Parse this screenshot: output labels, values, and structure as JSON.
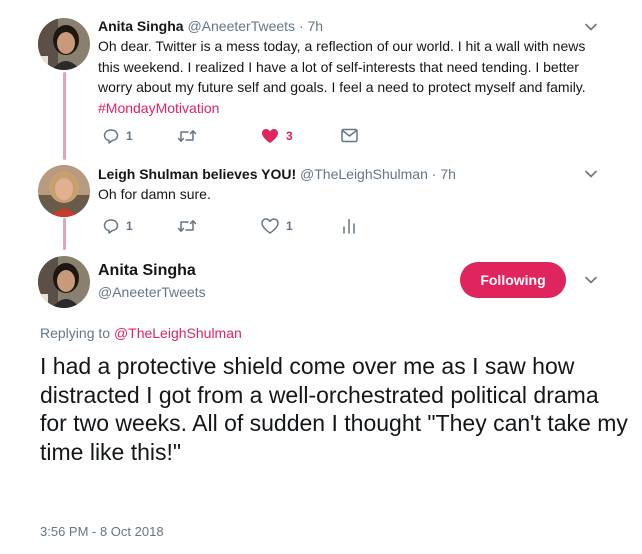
{
  "colors": {
    "accent": "#e0245e",
    "thread_line": "#e8a0b8",
    "muted": "#657786",
    "text": "#14171a"
  },
  "tweet1": {
    "name": "Anita Singha",
    "handle": "@AneeterTweets",
    "separator": "·",
    "time": "7h",
    "text_line1": "Oh dear. Twitter is a mess today, a reflection of our world. I hit a wall with news",
    "text_line2": "this weekend. I realized I have a lot of self-interests that need tending. I better",
    "text_line3": "worry about my future self and goals. I feel a need to protect myself and family.",
    "hashtag": "#MondayMotivation",
    "reply_count": "1",
    "like_count": "3",
    "icons": [
      "reply-icon",
      "retweet-icon",
      "heart-filled-icon",
      "mail-icon",
      "chevron-down-icon"
    ]
  },
  "tweet2": {
    "name": "Leigh Shulman believes YOU!",
    "handle": "@TheLeighShulman",
    "separator": "·",
    "time": "7h",
    "text": "Oh for damn sure.",
    "reply_count": "1",
    "like_count": "1",
    "icons": [
      "reply-icon",
      "retweet-icon",
      "heart-outline-icon",
      "analytics-icon",
      "chevron-down-icon"
    ]
  },
  "main_tweet": {
    "name": "Anita Singha",
    "handle": "@AneeterTweets",
    "follow_label": "Following",
    "replying_prefix": "Replying to",
    "replying_mention": "@TheLeighShulman",
    "text": "I had a protective shield come over me as I saw how distracted I got from a well-orchestrated political drama for two weeks. All of sudden I thought \"They can't take my time like this!\"",
    "timestamp": "3:56 PM - 8 Oct 2018"
  }
}
